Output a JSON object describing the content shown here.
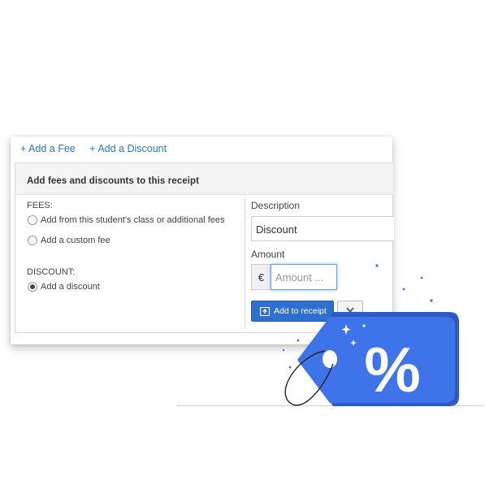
{
  "links": {
    "add_fee": "+ Add a Fee",
    "add_discount": "+ Add a Discount"
  },
  "panel": {
    "title": "Add fees and discounts to this receipt"
  },
  "fees": {
    "label": "FEES:",
    "options": [
      {
        "label": "Add from this student's class or additional fees",
        "selected": false
      },
      {
        "label": "Add a custom fee",
        "selected": false
      }
    ]
  },
  "discount": {
    "label": "DISCOUNT:",
    "options": [
      {
        "label": "Add a discount",
        "selected": true
      }
    ]
  },
  "form": {
    "description_label": "Description",
    "description_value": "Discount",
    "amount_label": "Amount",
    "currency_symbol": "€",
    "amount_placeholder": "Amount ...",
    "add_button": "Add to receipt"
  },
  "tag": {
    "symbol": "%",
    "color": "#3a6ee8"
  }
}
